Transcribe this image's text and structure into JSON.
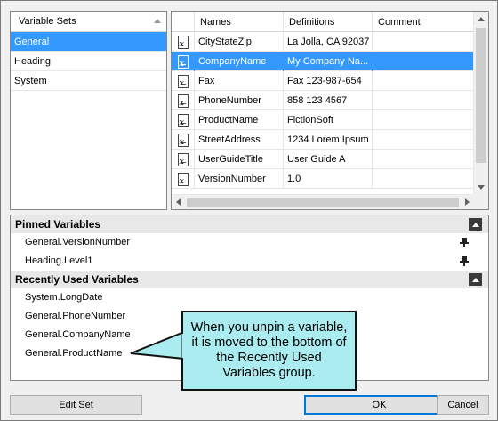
{
  "variable_sets": {
    "header": "Variable Sets",
    "items": [
      {
        "label": "General",
        "selected": true
      },
      {
        "label": "Heading",
        "selected": false
      },
      {
        "label": "System",
        "selected": false
      }
    ]
  },
  "variables_grid": {
    "columns": [
      "Names",
      "Definitions",
      "Comment"
    ],
    "rows": [
      {
        "name": "CityStateZip",
        "definition": "La Jolla, CA 92037",
        "comment": ""
      },
      {
        "name": "CompanyName",
        "definition": "My Company Na...",
        "comment": "",
        "selected": true
      },
      {
        "name": "Fax",
        "definition": "Fax 123-987-654",
        "comment": ""
      },
      {
        "name": "PhoneNumber",
        "definition": "858 123 4567",
        "comment": ""
      },
      {
        "name": "ProductName",
        "definition": "FictionSoft",
        "comment": ""
      },
      {
        "name": "StreetAddress",
        "definition": "1234 Lorem Ipsum",
        "comment": ""
      },
      {
        "name": "UserGuideTitle",
        "definition": "User Guide A",
        "comment": ""
      },
      {
        "name": "VersionNumber",
        "definition": "1.0",
        "comment": ""
      }
    ]
  },
  "pinned": {
    "title": "Pinned Variables",
    "items": [
      "General.VersionNumber",
      "Heading.Level1"
    ]
  },
  "recent": {
    "title": "Recently Used Variables",
    "items": [
      "System.LongDate",
      "General.PhoneNumber",
      "General.CompanyName",
      "General.ProductName"
    ]
  },
  "callout": {
    "text": "When you unpin a variable, it is moved to the bottom of the Recently Used Variables group.",
    "fill": "#aaecf0"
  },
  "buttons": {
    "edit_set": "Edit Set",
    "ok": "OK",
    "cancel": "Cancel"
  },
  "colors": {
    "selection": "#3399ff",
    "group_header": "#e8e8e8"
  },
  "icons": {
    "variable": "variable-x-icon",
    "pin": "pin-icon",
    "collapse": "collapse-up-icon",
    "sort": "sort-asc-icon"
  }
}
